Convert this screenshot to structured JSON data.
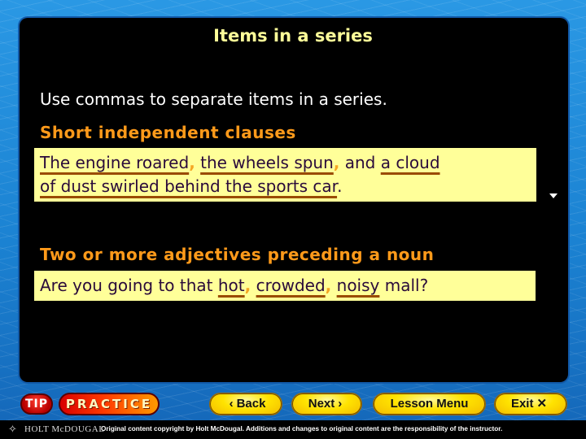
{
  "slide": {
    "title": "Items in a series",
    "intro": "Use commas to separate items in a series."
  },
  "sections": [
    {
      "heading": "Short independent clauses",
      "example": {
        "line1": [
          {
            "text": "The engine roared",
            "underline": true
          },
          {
            "text": ",",
            "comma": true
          },
          {
            "text": " "
          },
          {
            "text": "the wheels spun",
            "underline": true
          },
          {
            "text": ",",
            "comma": true
          },
          {
            "text": " and "
          },
          {
            "text": "a cloud",
            "underline": true
          }
        ],
        "line2": [
          {
            "text": "of dust swirled behind the sports car",
            "underline": true
          },
          {
            "text": "."
          }
        ]
      }
    },
    {
      "heading": "Two or more adjectives preceding a noun",
      "example": {
        "line1": [
          {
            "text": "Are you going to that "
          },
          {
            "text": "hot",
            "underline": true
          },
          {
            "text": ",",
            "comma": true
          },
          {
            "text": " "
          },
          {
            "text": "crowded",
            "underline": true
          },
          {
            "text": ",",
            "comma": true
          },
          {
            "text": " "
          },
          {
            "text": "noisy",
            "underline": true
          },
          {
            "text": " mall?"
          }
        ]
      }
    }
  ],
  "branding": {
    "tip": "TIP",
    "practice": "PRACTICE"
  },
  "nav": {
    "back": {
      "glyph": "‹",
      "label": "Back"
    },
    "next": {
      "label": "Next",
      "glyph": "›"
    },
    "menu": {
      "label": "Lesson Menu"
    },
    "exit": {
      "label": "Exit",
      "glyph": "✕"
    }
  },
  "footer": {
    "publisher": "HOLT McDOUGAL",
    "copyright": "Original content copyright by Holt McDougal. Additions and changes to original content are the responsibility of the instructor."
  },
  "colors": {
    "title": "#ffff99",
    "heading": "#ff9a1a",
    "example_bg": "#ffff99",
    "underline": "#9a4b00",
    "comma": "#f5a623"
  }
}
